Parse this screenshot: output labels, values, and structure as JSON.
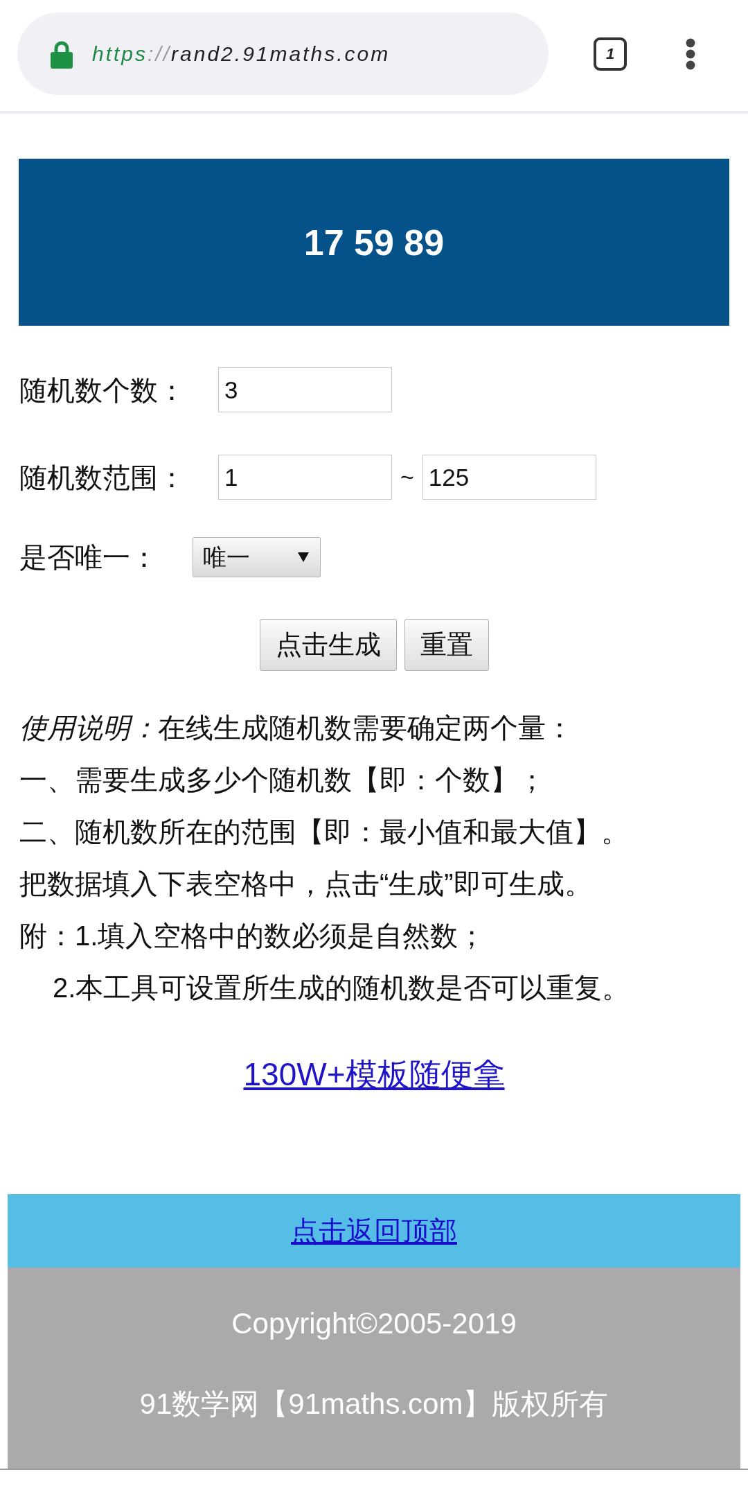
{
  "browser_bar": {
    "url": {
      "scheme": "https",
      "separator": "://",
      "host": "rand2.91maths.com"
    },
    "tab_count": "1"
  },
  "result": {
    "numbers": "17 59 89"
  },
  "form": {
    "count": {
      "label": "随机数个数：",
      "value": "3"
    },
    "range": {
      "label": "随机数范围：",
      "min": "1",
      "separator": "~",
      "max": "125"
    },
    "unique": {
      "label": "是否唯一：",
      "value": "唯一"
    },
    "buttons": [
      {
        "label": "点击生成"
      },
      {
        "label": "重置"
      }
    ]
  },
  "instructions": [
    {
      "label": "使用说明：",
      "text": "在线生成随机数需要确定两个量：",
      "indented": false
    },
    {
      "text": "一、需要生成多少个随机数【即：个数】；",
      "indented": false
    },
    {
      "text": "二、随机数所在的范围【即：最小值和最大值】。",
      "indented": false
    },
    {
      "text": "把数据填入下表空格中，点击“生成”即可生成。",
      "indented": false
    },
    {
      "text": "附：1.填入空格中的数必须是自然数；",
      "indented": false
    },
    {
      "text": "2.本工具可设置所生成的随机数是否可以重复。",
      "indented": true
    }
  ],
  "template_link": "130W+模板随便拿",
  "footer": {
    "back_to_top": "点击返回顶部",
    "lines": [
      "Copyright©2005-2019",
      "91数学网【91maths.com】版权所有"
    ]
  }
}
